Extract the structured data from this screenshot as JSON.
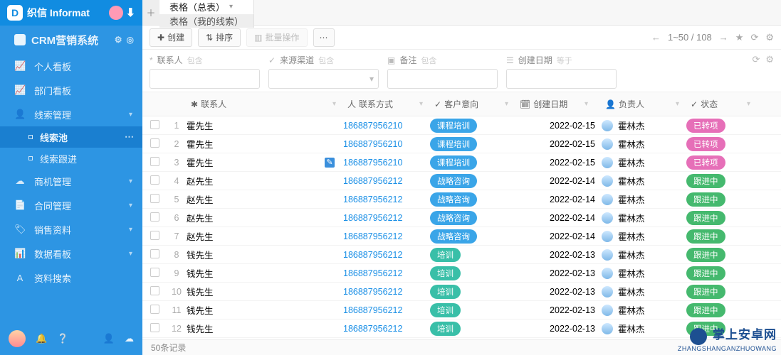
{
  "brand": {
    "logo_letter": "D",
    "name": "织信 Informat"
  },
  "app_title": "CRM营销系统",
  "sidebar": {
    "items": [
      {
        "icon": "chart",
        "label": "个人看板"
      },
      {
        "icon": "chart",
        "label": "部门看板"
      },
      {
        "icon": "user",
        "label": "线索管理",
        "expandable": true,
        "children": [
          {
            "label": "线索池",
            "active": true
          },
          {
            "label": "线索跟进"
          }
        ]
      },
      {
        "icon": "cloud",
        "label": "商机管理",
        "expandable": true
      },
      {
        "icon": "doc",
        "label": "合同管理",
        "expandable": true
      },
      {
        "icon": "tag",
        "label": "销售资料",
        "expandable": true
      },
      {
        "icon": "bars",
        "label": "数据看板",
        "expandable": true
      },
      {
        "icon": "a",
        "label": "资料搜索"
      }
    ]
  },
  "tabs": [
    {
      "label": "表格（总表）",
      "active": true,
      "dropdown": true
    },
    {
      "label": "表格（我的线索）"
    }
  ],
  "toolbar": {
    "create": "创建",
    "sort": "排序",
    "batch": "批量操作",
    "pager": "1~50 / 108"
  },
  "filters": [
    {
      "icon": "*",
      "label": "联系人",
      "hint": "包含"
    },
    {
      "icon": "✓",
      "label": "来源渠道",
      "hint": "包含",
      "select": true
    },
    {
      "icon": "▣",
      "label": "备注",
      "hint": "包含"
    },
    {
      "icon": "☰",
      "label": "创建日期",
      "hint": "等于"
    }
  ],
  "columns": {
    "contact": "联系人",
    "phone": "联系方式",
    "intent": "客户意向",
    "date": "创建日期",
    "owner": "负责人",
    "status": "状态"
  },
  "owner_name": "霍林杰",
  "rows": [
    {
      "n": 1,
      "name": "霍先生",
      "phone": "186887956210",
      "intent": "课程培训",
      "intent_c": "blue",
      "date": "2022-02-15",
      "status": "已转项",
      "status_c": "pink"
    },
    {
      "n": 2,
      "name": "霍先生",
      "phone": "186887956210",
      "intent": "课程培训",
      "intent_c": "blue",
      "date": "2022-02-15",
      "status": "已转项",
      "status_c": "pink"
    },
    {
      "n": 3,
      "name": "霍先生",
      "phone": "186887956210",
      "intent": "课程培训",
      "intent_c": "blue",
      "date": "2022-02-15",
      "status": "已转项",
      "status_c": "pink",
      "hover": true
    },
    {
      "n": 4,
      "name": "赵先生",
      "phone": "186887956212",
      "intent": "战略咨询",
      "intent_c": "blue",
      "date": "2022-02-14",
      "status": "跟进中",
      "status_c": "green"
    },
    {
      "n": 5,
      "name": "赵先生",
      "phone": "186887956212",
      "intent": "战略咨询",
      "intent_c": "blue",
      "date": "2022-02-14",
      "status": "跟进中",
      "status_c": "green"
    },
    {
      "n": 6,
      "name": "赵先生",
      "phone": "186887956212",
      "intent": "战略咨询",
      "intent_c": "blue",
      "date": "2022-02-14",
      "status": "跟进中",
      "status_c": "green"
    },
    {
      "n": 7,
      "name": "赵先生",
      "phone": "186887956212",
      "intent": "战略咨询",
      "intent_c": "blue",
      "date": "2022-02-14",
      "status": "跟进中",
      "status_c": "green"
    },
    {
      "n": 8,
      "name": "钱先生",
      "phone": "186887956212",
      "intent": "培训",
      "intent_c": "teal",
      "date": "2022-02-13",
      "status": "跟进中",
      "status_c": "green"
    },
    {
      "n": 9,
      "name": "钱先生",
      "phone": "186887956212",
      "intent": "培训",
      "intent_c": "teal",
      "date": "2022-02-13",
      "status": "跟进中",
      "status_c": "green"
    },
    {
      "n": 10,
      "name": "钱先生",
      "phone": "186887956212",
      "intent": "培训",
      "intent_c": "teal",
      "date": "2022-02-13",
      "status": "跟进中",
      "status_c": "green"
    },
    {
      "n": 11,
      "name": "钱先生",
      "phone": "186887956212",
      "intent": "培训",
      "intent_c": "teal",
      "date": "2022-02-13",
      "status": "跟进中",
      "status_c": "green"
    },
    {
      "n": 12,
      "name": "钱先生",
      "phone": "186887956212",
      "intent": "培训",
      "intent_c": "teal",
      "date": "2022-02-13",
      "status": "跟进中",
      "status_c": "green"
    }
  ],
  "footer": "50条记录",
  "watermark": {
    "text": "掌上安卓网",
    "url": "ZHANGSHANGANZHUOWANG"
  }
}
